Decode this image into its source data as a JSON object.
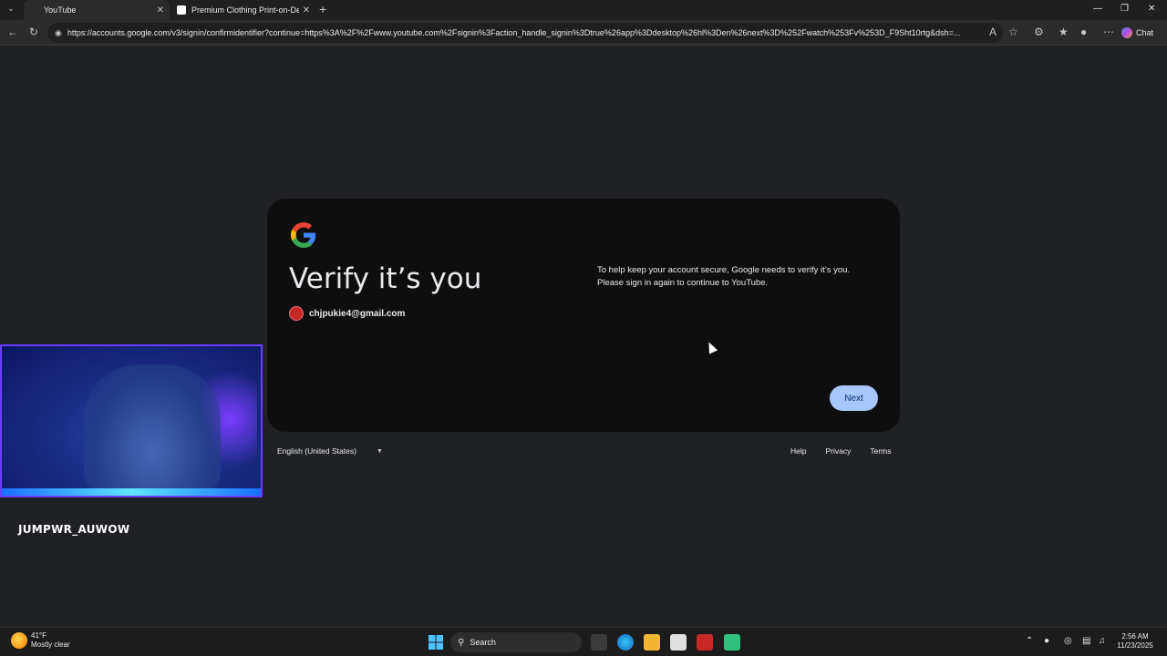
{
  "browser": {
    "tabs": [
      {
        "title": "YouTube",
        "active": true
      },
      {
        "title": "Premium Clothing Print-on-Dem",
        "active": false
      }
    ],
    "url": "https://accounts.google.com/v3/signin/confirmidentifier?continue=https%3A%2F%2Fwww.youtube.com%2Fsignin%3Faction_handle_signin%3Dtrue%26app%3Ddesktop%26hl%3Den%26next%3D%252Fwatch%253Fv%253D_F9Sht10rtg&dsh=...",
    "chat_label": "Chat"
  },
  "signin": {
    "title": "Verify it’s you",
    "email": "chjpukie4@gmail.com",
    "message": "To help keep your account secure, Google needs to verify it’s you. Please sign in again to continue to YouTube.",
    "next_label": "Next"
  },
  "footer": {
    "language": "English (United States)",
    "links": [
      "Help",
      "Privacy",
      "Terms"
    ]
  },
  "overlay": {
    "streamer_name": "JUMPWR_AUWOW"
  },
  "taskbar": {
    "weather_temp": "41°F",
    "weather_desc": "Mostly clear",
    "search_label": "Search",
    "time": "2:56 AM",
    "date": "11/23/2025"
  },
  "colors": {
    "accent_button": "#a8c7fa",
    "card_bg": "#0e0e0e",
    "page_bg": "#202124"
  }
}
